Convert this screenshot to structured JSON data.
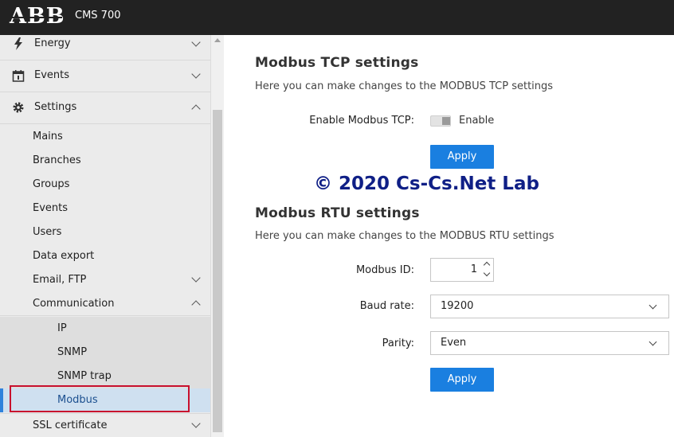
{
  "header": {
    "logo": "ABB",
    "app_title": "CMS 700"
  },
  "sidebar": {
    "top_items": [
      {
        "label": "Energy",
        "icon": "lightning-icon",
        "expanded": false
      },
      {
        "label": "Events",
        "icon": "calendar-icon",
        "expanded": false
      },
      {
        "label": "Settings",
        "icon": "gear-icon",
        "expanded": true
      }
    ],
    "settings_items": [
      {
        "label": "Mains"
      },
      {
        "label": "Branches"
      },
      {
        "label": "Groups"
      },
      {
        "label": "Events"
      },
      {
        "label": "Users"
      },
      {
        "label": "Data export"
      },
      {
        "label": "Email, FTP",
        "expandable": true,
        "expanded": false
      },
      {
        "label": "Communication",
        "expandable": true,
        "expanded": true
      }
    ],
    "communication_items": [
      {
        "label": "IP"
      },
      {
        "label": "SNMP"
      },
      {
        "label": "SNMP trap"
      },
      {
        "label": "Modbus",
        "active": true
      }
    ],
    "bottom_item": {
      "label": "SSL certificate",
      "expandable": true,
      "expanded": false
    }
  },
  "tcp": {
    "heading": "Modbus TCP settings",
    "description": "Here you can make changes to the MODBUS TCP settings",
    "enable_label": "Enable Modbus TCP:",
    "toggle_text": "Enable",
    "apply": "Apply"
  },
  "watermark": "© 2020 Cs-Cs.Net Lab",
  "rtu": {
    "heading": "Modbus RTU settings",
    "description": "Here you can make changes to the MODBUS RTU settings",
    "id_label": "Modbus ID:",
    "id_value": "1",
    "baud_label": "Baud rate:",
    "baud_value": "19200",
    "parity_label": "Parity:",
    "parity_value": "Even",
    "apply": "Apply"
  },
  "colors": {
    "accent": "#1a7fe0",
    "active_item_bg": "#cfe0f0",
    "highlight": "#c8102e",
    "topbar": "#222222"
  }
}
